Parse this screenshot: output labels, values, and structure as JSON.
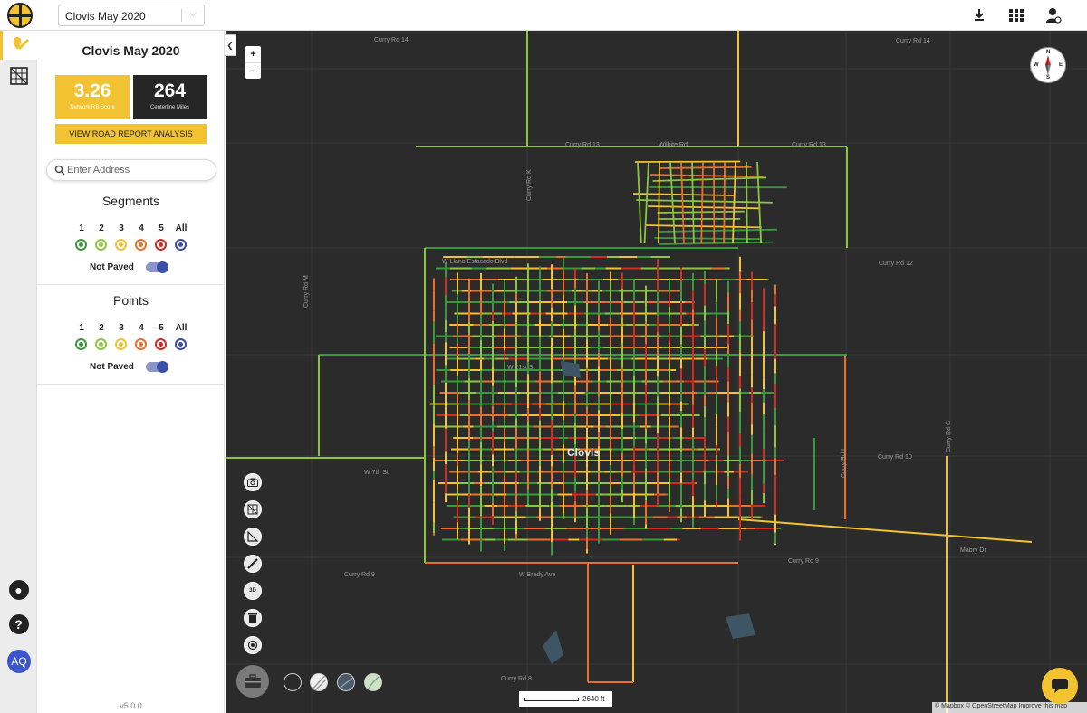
{
  "header": {
    "project_selected": "Clovis May 2020",
    "download_icon": "download-icon",
    "grid_icon": "grid-icon",
    "user_icon": "user-settings-icon"
  },
  "leftbar": {
    "items": [
      "location-pin-icon",
      "map-grid-icon"
    ],
    "bottom": [
      "bell-icon",
      "help-icon",
      "gear-icon"
    ],
    "avatar_initials": "AQ"
  },
  "panel": {
    "title": "Clovis May 2020",
    "score_value": "3.26",
    "score_label": "Network RB Score",
    "miles_value": "264",
    "miles_label": "Centerline Miles",
    "report_button": "VIEW ROAD REPORT ANALYSIS",
    "search_placeholder": "Enter Address",
    "segments": {
      "title": "Segments",
      "levels": [
        "1",
        "2",
        "3",
        "4",
        "5",
        "All"
      ],
      "toggle_label": "Not Paved"
    },
    "points": {
      "title": "Points",
      "levels": [
        "1",
        "2",
        "3",
        "4",
        "5",
        "All"
      ],
      "toggle_label": "Not Paved"
    },
    "version": "v5.0.0"
  },
  "colors": {
    "accent": "#f2c230",
    "level_1": "#3a9a3a",
    "level_2": "#8cc63f",
    "level_3": "#f2c230",
    "level_4": "#e8702a",
    "level_5": "#d42a1f",
    "level_all": "#3b4ea8",
    "map_bg": "#2b2b2b"
  },
  "map": {
    "zoom_in": "+",
    "zoom_out": "−",
    "compass": {
      "n": "N",
      "s": "S",
      "e": "E",
      "w": "W"
    },
    "city_label": "Clovis",
    "road_labels": [
      "Curry Rd 14",
      "Curry Rd 14",
      "Curry Rd 13",
      "Wilhite Rd",
      "Curry Rd 13",
      "Curry Rd K",
      "Curry Rd M",
      "Curry Rd 12",
      "W Llano Estacado Blvd",
      "W 21st St",
      "W 7th St",
      "Curry Rd 10",
      "Curry Rd 9",
      "W Brady Ave",
      "Curry Rd 9",
      "Curry Rd 8",
      "Mabry Dr",
      "Curry Rd G",
      "Curry Rd I"
    ],
    "tools": [
      "camera-icon",
      "map-export-icon",
      "area-measure-icon",
      "ruler-icon",
      "3d-icon",
      "trash-icon",
      "locate-icon"
    ],
    "tool_3d_label": "3D",
    "basemaps": [
      "dark-basemap",
      "streets-basemap",
      "satellite-basemap",
      "terrain-basemap"
    ],
    "scale_label": "2640 ft",
    "attribution": "© Mapbox © OpenStreetMap Improve this map"
  }
}
